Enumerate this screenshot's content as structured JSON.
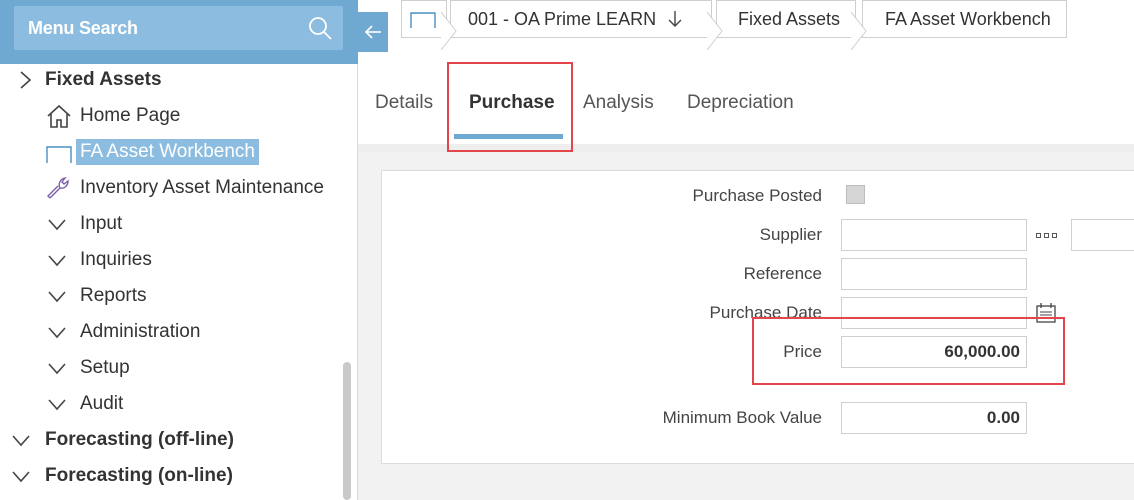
{
  "sidebar": {
    "search_label": "Menu Search",
    "tree": [
      {
        "label": "Fixed Assets",
        "bold": true,
        "icon": "chevron-right-icon"
      },
      {
        "label": "Home Page",
        "icon": "home-icon"
      },
      {
        "label": "FA Asset Workbench",
        "icon": "workbench-icon",
        "selected": true
      },
      {
        "label": "Inventory Asset Maintenance",
        "icon": "wrench-icon"
      },
      {
        "label": "Input",
        "icon": "chevron-down-icon"
      },
      {
        "label": "Inquiries",
        "icon": "chevron-down-icon"
      },
      {
        "label": "Reports",
        "icon": "chevron-down-icon"
      },
      {
        "label": "Administration",
        "icon": "chevron-down-icon"
      },
      {
        "label": "Setup",
        "icon": "chevron-down-icon"
      },
      {
        "label": "Audit",
        "icon": "chevron-down-icon"
      },
      {
        "label": "Forecasting (off-line)",
        "bold": true,
        "icon": "chevron-down-icon"
      },
      {
        "label": "Forecasting (on-line)",
        "bold": true,
        "icon": "chevron-down-icon"
      }
    ]
  },
  "breadcrumb": {
    "company": "001 - OA Prime LEARN",
    "module": "Fixed Assets",
    "page": "FA Asset Workbench"
  },
  "tabs": [
    {
      "label": "Details"
    },
    {
      "label": "Purchase",
      "active": true
    },
    {
      "label": "Analysis"
    },
    {
      "label": "Depreciation"
    }
  ],
  "form": {
    "purchase_posted_label": "Purchase Posted",
    "purchase_posted_checked": false,
    "supplier_label": "Supplier",
    "supplier_value": "",
    "reference_label": "Reference",
    "reference_value": "",
    "purchase_date_label": "Purchase Date",
    "purchase_date_value": "",
    "price_label": "Price",
    "price_value": "60,000.00",
    "min_book_value_label": "Minimum Book Value",
    "min_book_value_value": "0.00"
  },
  "colors": {
    "accent": "#6fa8d1",
    "accent_light": "#8cbde0",
    "highlight": "#e2464a"
  }
}
